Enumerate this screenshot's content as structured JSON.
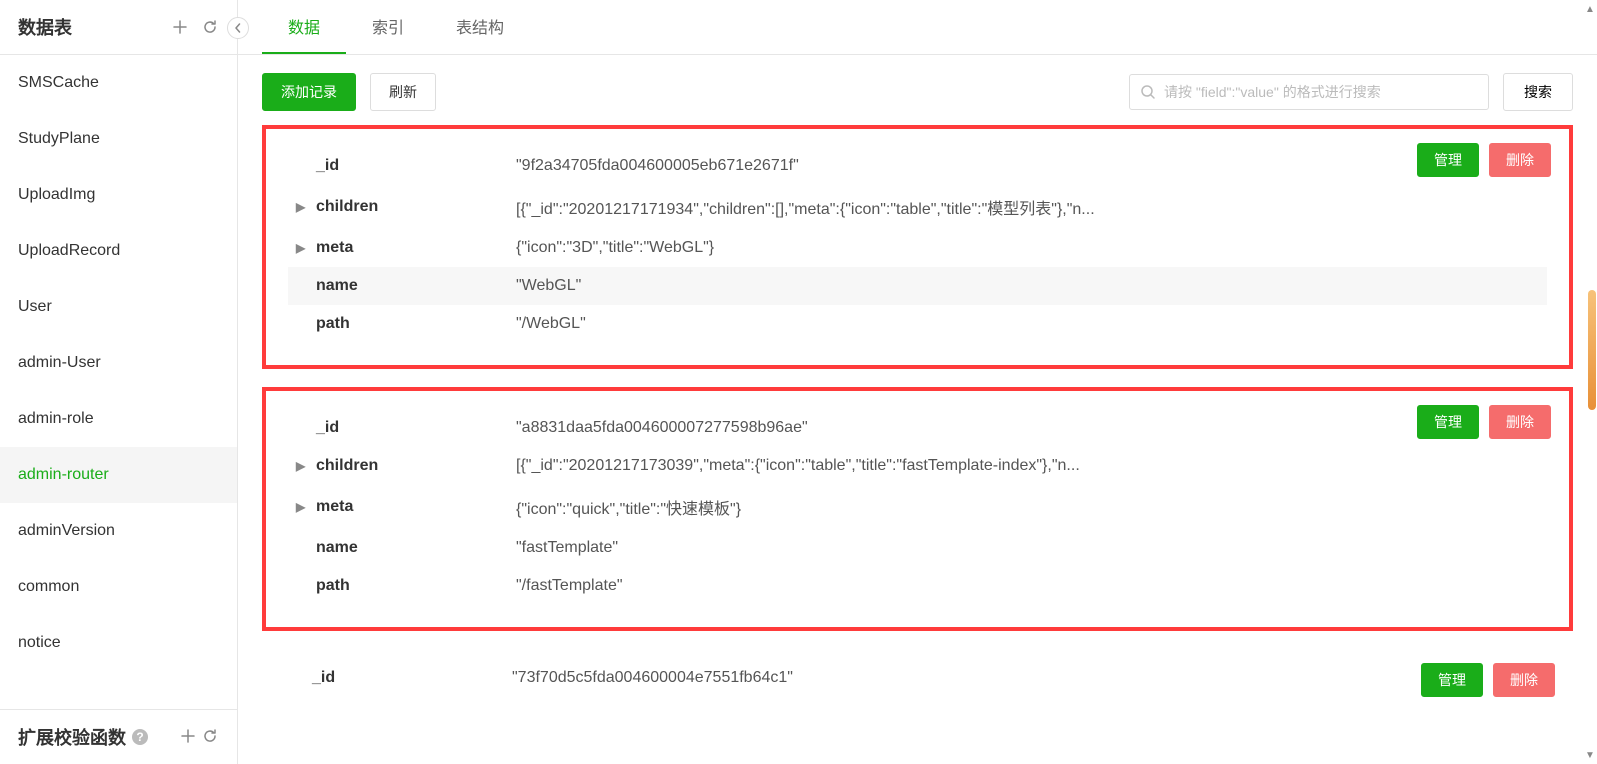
{
  "sidebar": {
    "header_title": "数据表",
    "footer_title": "扩展校验函数",
    "items": [
      {
        "label": "SMSCache",
        "active": false
      },
      {
        "label": "StudyPlane",
        "active": false
      },
      {
        "label": "UploadImg",
        "active": false
      },
      {
        "label": "UploadRecord",
        "active": false
      },
      {
        "label": "User",
        "active": false
      },
      {
        "label": "admin-User",
        "active": false
      },
      {
        "label": "admin-role",
        "active": false
      },
      {
        "label": "admin-router",
        "active": true
      },
      {
        "label": "adminVersion",
        "active": false
      },
      {
        "label": "common",
        "active": false
      },
      {
        "label": "notice",
        "active": false
      }
    ]
  },
  "tabs": [
    {
      "label": "数据",
      "active": true
    },
    {
      "label": "索引",
      "active": false
    },
    {
      "label": "表结构",
      "active": false
    }
  ],
  "toolbar": {
    "add_label": "添加记录",
    "refresh_label": "刷新",
    "search_placeholder": "请按 \"field\":\"value\" 的格式进行搜索",
    "search_button": "搜索"
  },
  "record_buttons": {
    "manage": "管理",
    "delete": "删除"
  },
  "records": [
    {
      "highlighted": true,
      "fields": [
        {
          "key": "_id",
          "value": "\"9f2a34705fda004600005eb671e2671f\"",
          "expandable": false,
          "hover": false
        },
        {
          "key": "children",
          "value": "[{\"_id\":\"20201217171934\",\"children\":[],\"meta\":{\"icon\":\"table\",\"title\":\"模型列表\"},\"n...",
          "expandable": true,
          "hover": false
        },
        {
          "key": "meta",
          "value": "{\"icon\":\"3D\",\"title\":\"WebGL\"}",
          "expandable": true,
          "hover": false
        },
        {
          "key": "name",
          "value": "\"WebGL\"",
          "expandable": false,
          "hover": true
        },
        {
          "key": "path",
          "value": "\"/WebGL\"",
          "expandable": false,
          "hover": false
        }
      ]
    },
    {
      "highlighted": true,
      "fields": [
        {
          "key": "_id",
          "value": "\"a8831daa5fda004600007277598b96ae\"",
          "expandable": false,
          "hover": false
        },
        {
          "key": "children",
          "value": "[{\"_id\":\"20201217173039\",\"meta\":{\"icon\":\"table\",\"title\":\"fastTemplate-index\"},\"n...",
          "expandable": true,
          "hover": false
        },
        {
          "key": "meta",
          "value": "{\"icon\":\"quick\",\"title\":\"快速模板\"}",
          "expandable": true,
          "hover": false
        },
        {
          "key": "name",
          "value": "\"fastTemplate\"",
          "expandable": false,
          "hover": false
        },
        {
          "key": "path",
          "value": "\"/fastTemplate\"",
          "expandable": false,
          "hover": false
        }
      ]
    },
    {
      "highlighted": false,
      "fields": [
        {
          "key": "_id",
          "value": "\"73f70d5c5fda004600004e7551fb64c1\"",
          "expandable": false,
          "hover": false
        }
      ]
    }
  ]
}
